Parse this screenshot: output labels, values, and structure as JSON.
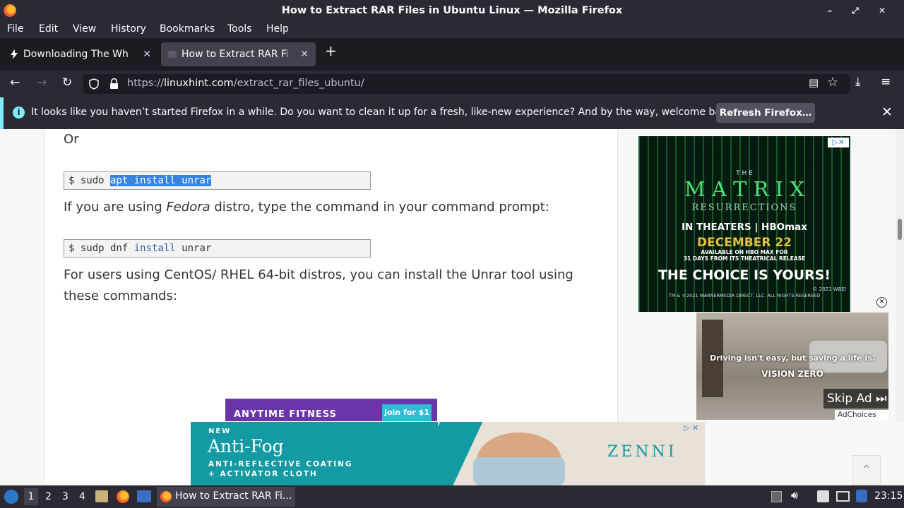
{
  "window": {
    "title": "How to Extract RAR Files in Ubuntu Linux — Mozilla Firefox",
    "controls": "– ⤢ ✕"
  },
  "menu": [
    "File",
    "Edit",
    "View",
    "History",
    "Bookmarks",
    "Tools",
    "Help"
  ],
  "tabs": [
    {
      "label": "Downloading The White M",
      "close": "✕"
    },
    {
      "label": "How to Extract RAR Files",
      "close": "✕"
    }
  ],
  "newtab": "+",
  "nav": {
    "url_prefix": "https://",
    "url_host": "linuxhint.com",
    "url_path": "/extract_rar_files_ubuntu/"
  },
  "notification": {
    "message": "It looks like you haven’t started Firefox in a while. Do you want to clean it up for a fresh, like-new experience? And by the way, welcome back!",
    "button": "Refresh Firefox…"
  },
  "article": {
    "or": "Or",
    "cmd1": {
      "prompt": "$ sudo ",
      "selected": "apt install unrar"
    },
    "fedora_pre": "If you are using ",
    "fedora_em": "Fedora",
    "fedora_post": " distro, type the command in your command prompt:",
    "cmd2": {
      "prompt": "$ sudp dnf ",
      "kw": "install",
      "rest": " unrar"
    },
    "centos_line1": "For users using CentOS/ RHEL 64-bit distros, you can install the Unrar tool using",
    "centos_line2": "these commands:"
  },
  "ads": {
    "matrix": {
      "the": "T H E",
      "title": "M A T R I X",
      "sub": "RESURRECTIONS",
      "theaters": "IN THEATERS | HBOmax",
      "date": "DECEMBER 22",
      "avail1": "AVAILABLE ON HBO MAX FOR",
      "avail2": "31 DAYS FROM ITS THEATRICAL RELEASE",
      "choice": "THE CHOICE IS YOURS!",
      "legal1": "© 2021 WBEI",
      "legal2": "TM & ©2021 WARNERMEDIA DIRECT, LLC. ALL RIGHTS RESERVED"
    },
    "video": {
      "caption": "Driving isn't easy, but saving a life is.",
      "brand": "VISION ZERO",
      "skip": "Skip Ad",
      "adchoices": "AdChoices"
    },
    "anytime": {
      "brand": "ANYTIME FITNESS",
      "cta": "Join for $1"
    },
    "zenni": {
      "new": "NEW",
      "title": "Anti-Fog",
      "line1": "ANTI-REFLECTIVE COATING",
      "line2": "+ ACTIVATOR CLOTH",
      "brand": "ZENNI"
    }
  },
  "taskbar": {
    "workspaces": [
      "1",
      "2",
      "3",
      "4"
    ],
    "task": "How to Extract RAR Fi...",
    "clock": "23:15"
  }
}
